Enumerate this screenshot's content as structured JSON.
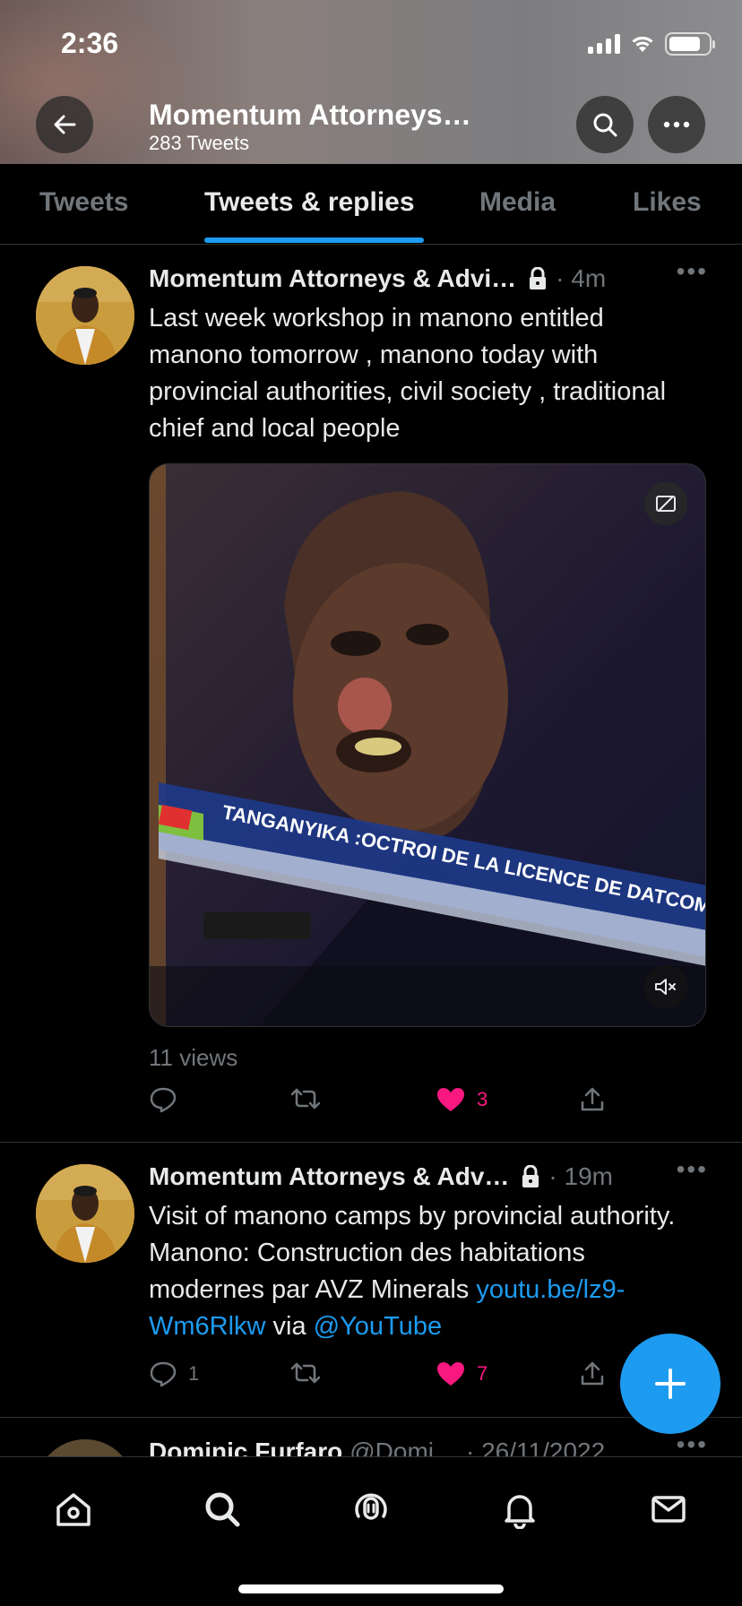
{
  "status_bar": {
    "time": "2:36"
  },
  "profile_header": {
    "title": "Momentum Attorneys…",
    "tweet_count": "283 Tweets"
  },
  "tabs": [
    {
      "label": "Tweets"
    },
    {
      "label": "Tweets & replies"
    },
    {
      "label": "Media"
    },
    {
      "label": "Likes"
    }
  ],
  "tweets": [
    {
      "name": "Momentum Attorneys & Advi…",
      "meta": "· 4m",
      "text": "Last week workshop in manono entitled manono tomorrow , manono today with provincial authorities, civil society , traditional chief and local people",
      "media_caption": "TANGANYIKA :OCTROI DE LA LICENCE DE DATCOM MINING",
      "views": "11 views",
      "replies": "",
      "retweets": "",
      "likes": "3"
    },
    {
      "name": "Momentum Attorneys & Adv…",
      "meta": "· 19m",
      "text_pre": "Visit of manono camps by provincial authority. Manono: Construction des habitations modernes par AVZ Minerals",
      "link": "youtu.be/lz9-Wm6Rlkw",
      "via": " via ",
      "mention": "@YouTube",
      "replies": "1",
      "retweets": "",
      "likes": "7"
    },
    {
      "name": "Dominic Furfaro",
      "handle": "@Domi…",
      "meta": "· 26/11/2022"
    }
  ],
  "colors": {
    "accent": "#1d9bf0",
    "like": "#f91880",
    "muted": "#71767b"
  },
  "icons": [
    "back-arrow-icon",
    "search-icon",
    "more-icon",
    "lock-icon",
    "reply-icon",
    "retweet-icon",
    "heart-icon",
    "share-icon",
    "plus-icon",
    "home-icon",
    "spaces-icon",
    "bell-icon",
    "mail-icon"
  ]
}
